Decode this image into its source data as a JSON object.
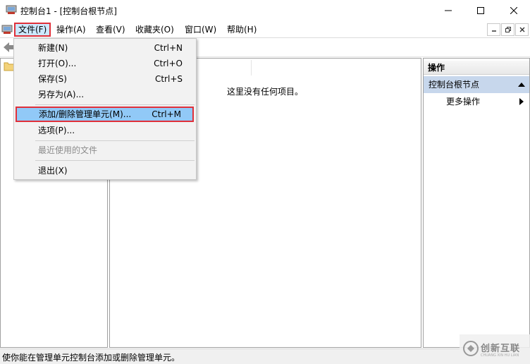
{
  "window": {
    "title": "控制台1 - [控制台根节点]"
  },
  "menubar": {
    "items": [
      "文件(F)",
      "操作(A)",
      "查看(V)",
      "收藏夹(O)",
      "窗口(W)",
      "帮助(H)"
    ]
  },
  "file_menu": {
    "items": [
      {
        "label": "新建(N)",
        "shortcut": "Ctrl+N"
      },
      {
        "label": "打开(O)...",
        "shortcut": "Ctrl+O"
      },
      {
        "label": "保存(S)",
        "shortcut": "Ctrl+S"
      },
      {
        "label": "另存为(A)...",
        "shortcut": ""
      },
      {
        "label": "添加/删除管理单元(M)...",
        "shortcut": "Ctrl+M"
      },
      {
        "label": "选项(P)...",
        "shortcut": ""
      },
      {
        "label": "最近使用的文件",
        "shortcut": ""
      },
      {
        "label": "退出(X)",
        "shortcut": ""
      }
    ]
  },
  "center": {
    "empty_message": "这里没有任何项目。"
  },
  "actions_pane": {
    "header": "操作",
    "node": "控制台根节点",
    "more": "更多操作"
  },
  "statusbar": {
    "text": "使你能在管理单元控制台添加或删除管理单元。"
  },
  "watermark": {
    "text": "创新互联",
    "sub": "CHUANG XIN HU LIAN"
  },
  "colors": {
    "highlight_border": "#e0303a",
    "menu_highlight": "#91c9f7",
    "actions_node_bg": "#c7d7ec"
  }
}
